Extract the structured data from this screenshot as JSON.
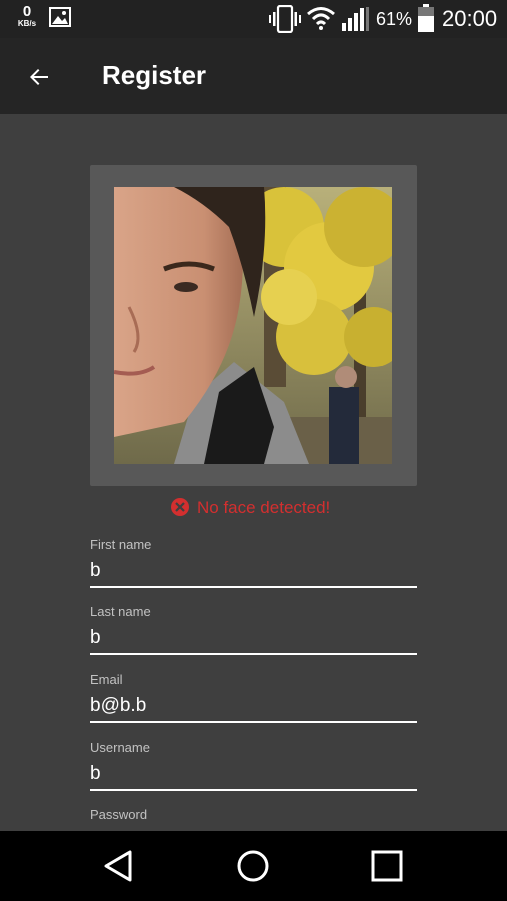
{
  "status_bar": {
    "network_speed": "0",
    "network_unit": "KB/s",
    "battery_percent": "61%",
    "time": "20:00"
  },
  "app_bar": {
    "title": "Register"
  },
  "photo": {
    "error_message": "No face detected!"
  },
  "form": {
    "fields": [
      {
        "label": "First name",
        "value": "b"
      },
      {
        "label": "Last name",
        "value": "b"
      },
      {
        "label": "Email",
        "value": "b@b.b"
      },
      {
        "label": "Username",
        "value": "b"
      },
      {
        "label": "Password",
        "value": ""
      }
    ]
  },
  "colors": {
    "background": "#3f3f3f",
    "app_bar": "#252525",
    "status_bar": "#222222",
    "error": "#d32f2f",
    "nav_bar": "#000000"
  }
}
